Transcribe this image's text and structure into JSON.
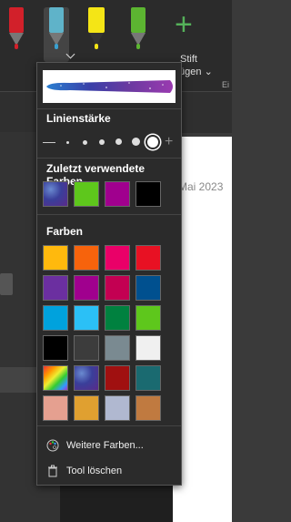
{
  "ribbon": {
    "pens": [
      {
        "name": "pen-red",
        "body": "#d2202a",
        "nib": "#d2202a"
      },
      {
        "name": "pen-galaxy",
        "body": "#5fb3c9",
        "nib": "#3aa0d0"
      },
      {
        "name": "highlighter-yellow",
        "body": "#f4e516",
        "nib": "#f4e516"
      },
      {
        "name": "pen-green",
        "body": "#5cb531",
        "nib": "#5cb531"
      }
    ],
    "add_pen_line1": "Stift",
    "add_pen_line2": "fügen",
    "group_label": "Ei"
  },
  "page": {
    "date": "Mai 2023"
  },
  "panel": {
    "line_width_title": "Linienstärke",
    "recent_title": "Zuletzt verwendete Farben",
    "colors_title": "Farben",
    "more_colors": "Weitere Farben...",
    "delete_tool": "Tool löschen",
    "recent_colors": [
      {
        "name": "galaxy",
        "color": "#3a4a9a",
        "pattern": "galaxy"
      },
      {
        "name": "green",
        "color": "#5ec71c"
      },
      {
        "name": "purple",
        "color": "#a0008e"
      },
      {
        "name": "black",
        "color": "#000000"
      }
    ],
    "color_grid": [
      [
        "#ffb90d",
        "#f7630c",
        "#ea0068",
        "#e81123"
      ],
      [
        "#6b2fa0",
        "#a0008e",
        "#c30052",
        "#00508f"
      ],
      [
        "#00a2dd",
        "#2bc0f6",
        "#00813f",
        "#5ec71c"
      ],
      [
        "#000000",
        "#3c3c3c",
        "#7a8a91",
        "#f0f0f0"
      ],
      [
        "rainbow",
        "galaxy",
        "#a01010",
        "#1a6a70"
      ],
      [
        "#e5a090",
        "#e0a030",
        "#b0b8d0",
        "#c07a40"
      ]
    ]
  }
}
